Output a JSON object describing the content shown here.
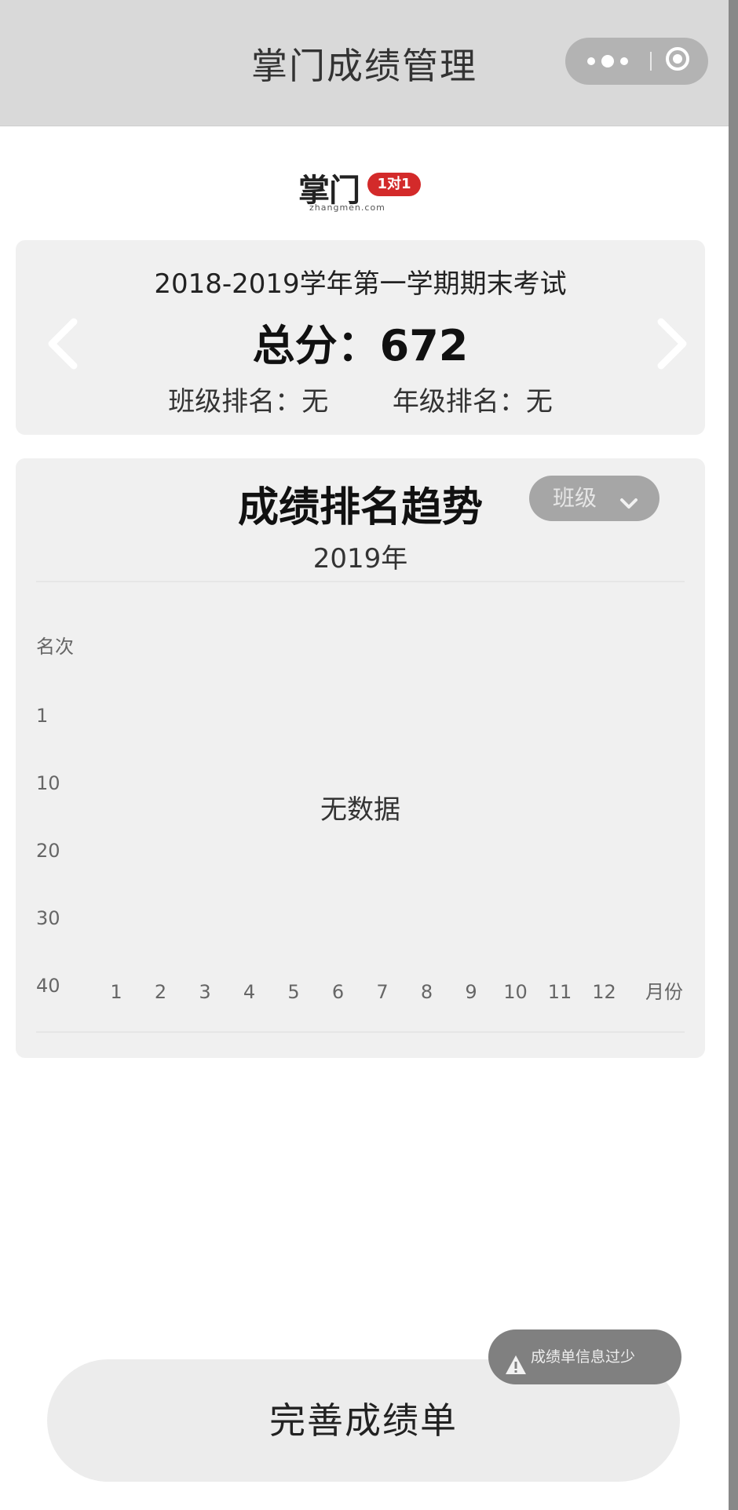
{
  "header": {
    "title": "掌门成绩管理"
  },
  "logo": {
    "main": "掌门",
    "badge": "1对1",
    "sub": "zhangmen.com"
  },
  "score_card": {
    "exam_name": "2018-2019学年第一学期期末考试",
    "total_label": "总分：",
    "total_value": "672",
    "class_rank_label": "班级排名：",
    "class_rank_value": "无",
    "grade_rank_label": "年级排名：",
    "grade_rank_value": "无"
  },
  "trend": {
    "title": "成绩排名趋势",
    "dropdown_value": "班级",
    "year": "2019年",
    "no_data": "无数据"
  },
  "chart_data": {
    "type": "line",
    "ylabel": "名次",
    "xlabel": "月份",
    "y_ticks": [
      "1",
      "10",
      "20",
      "30",
      "40"
    ],
    "categories": [
      "1",
      "2",
      "3",
      "4",
      "5",
      "6",
      "7",
      "8",
      "9",
      "10",
      "11",
      "12"
    ],
    "series": [],
    "ylim": [
      40,
      1
    ]
  },
  "bottom": {
    "complete_button": "完善成绩单",
    "hint": "成绩单信息过少"
  },
  "colors": {
    "header_bg": "#d9d9d9",
    "card_bg": "#f0f0f0",
    "logo_red": "#d32a2a",
    "pill_gray": "#808080"
  },
  "icons": [
    "more-dots-icon",
    "close-target-icon",
    "chevron-left-icon",
    "chevron-right-icon",
    "chevron-down-icon",
    "warning-icon"
  ]
}
